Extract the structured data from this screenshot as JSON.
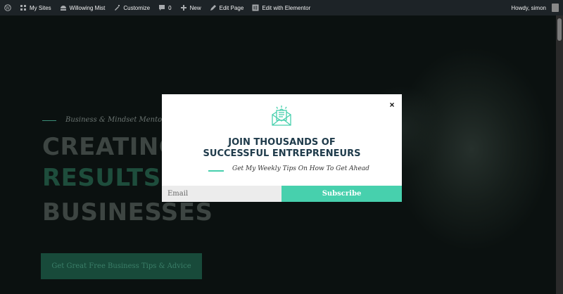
{
  "adminbar": {
    "items": [
      {
        "icon": "wordpress-icon",
        "label": ""
      },
      {
        "icon": "my-sites-icon",
        "label": "My Sites"
      },
      {
        "icon": "site-icon",
        "label": "Willowing Mist"
      },
      {
        "icon": "customize-icon",
        "label": "Customize"
      },
      {
        "icon": "comments-icon",
        "label": "0"
      },
      {
        "icon": "new-icon",
        "label": "New"
      },
      {
        "icon": "edit-icon",
        "label": "Edit Page"
      },
      {
        "icon": "elementor-icon",
        "label": "Edit with Elementor"
      }
    ],
    "greeting": "Howdy, simon"
  },
  "hero": {
    "eyebrow": "Business & Mindset Mentor",
    "headline": [
      "CREATING",
      "RESULTS ",
      "BUSINESSES"
    ],
    "cta_label": "Get Great Free Business Tips & Advice"
  },
  "popup": {
    "close": "×",
    "title": "JOIN THOUSANDS OF SUCCESSFUL ENTREPRENEURS",
    "subtitle": "Get My Weekly Tips On How To Get Ahead",
    "email_placeholder": "Email",
    "email_value": "",
    "subscribe_label": "Subscribe",
    "accent_color": "#47d0ad",
    "icon": "newsletter-envelope-icon"
  }
}
